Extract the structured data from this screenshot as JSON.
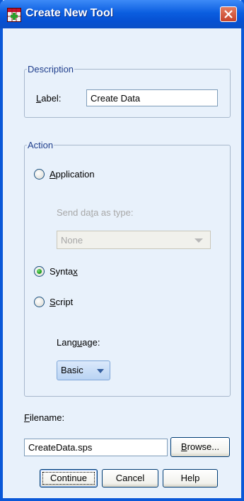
{
  "window": {
    "title": "Create New Tool",
    "icon": "tool-grid-icon",
    "close_icon": "close-icon"
  },
  "description": {
    "legend": "Description",
    "label_caption": "Label:",
    "label_value": "Create Data"
  },
  "action": {
    "legend": "Action",
    "options": [
      {
        "label": "Application",
        "checked": false
      },
      {
        "label": "Syntax",
        "checked": true
      },
      {
        "label": "Script",
        "checked": false
      }
    ],
    "send_data_label": "Send data as type:",
    "send_data_value": "None",
    "language_label": "Language:",
    "language_value": "Basic"
  },
  "filename": {
    "label": "Filename:",
    "value": "CreateData.sps",
    "browse_label": "Browse..."
  },
  "buttons": {
    "continue": "Continue",
    "cancel": "Cancel",
    "help": "Help"
  },
  "colors": {
    "title_bar": "#0b5ee0",
    "window_bg": "#e8f1fb",
    "legend_text": "#1f3e8c",
    "radio_selected": "#21a121"
  }
}
